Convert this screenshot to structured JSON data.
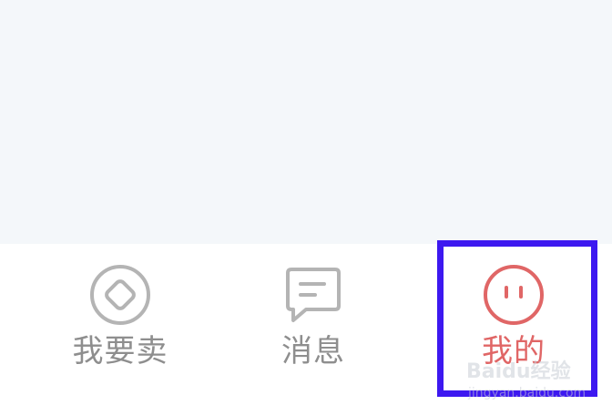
{
  "tabbar": {
    "items": [
      {
        "label": "我要卖",
        "icon": "sell-coin-icon",
        "color": "#a8a8a8"
      },
      {
        "label": "消息",
        "icon": "message-bubble-icon",
        "color": "#a8a8a8"
      },
      {
        "label": "我的",
        "icon": "profile-face-icon",
        "color": "#e06666",
        "active": true
      }
    ]
  },
  "highlight": {
    "color": "#3d18f0",
    "target": "我的"
  },
  "watermark": {
    "logo": "Baidu经验",
    "url": "jingyan.baidu.com"
  }
}
